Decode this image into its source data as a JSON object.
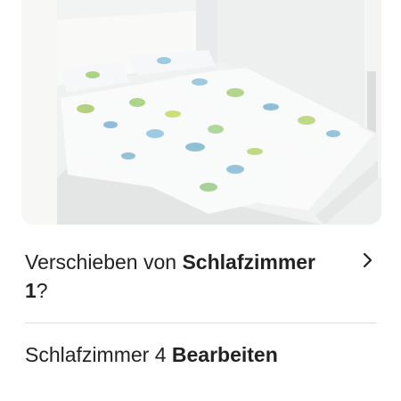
{
  "photo": {
    "alt": "Bett im Schlafzimmer"
  },
  "move_prompt": {
    "prefix": "Verschieben von ",
    "room": "Schlafzimmer 1",
    "suffix": "?"
  },
  "room_row": {
    "label": "Schlafzimmer 4",
    "edit_label": "Bearbeiten"
  },
  "icons": {
    "chevron": "chevron-right-icon"
  },
  "colors": {
    "text": "#222222",
    "divider": "#dddddd",
    "background": "#ffffff"
  }
}
